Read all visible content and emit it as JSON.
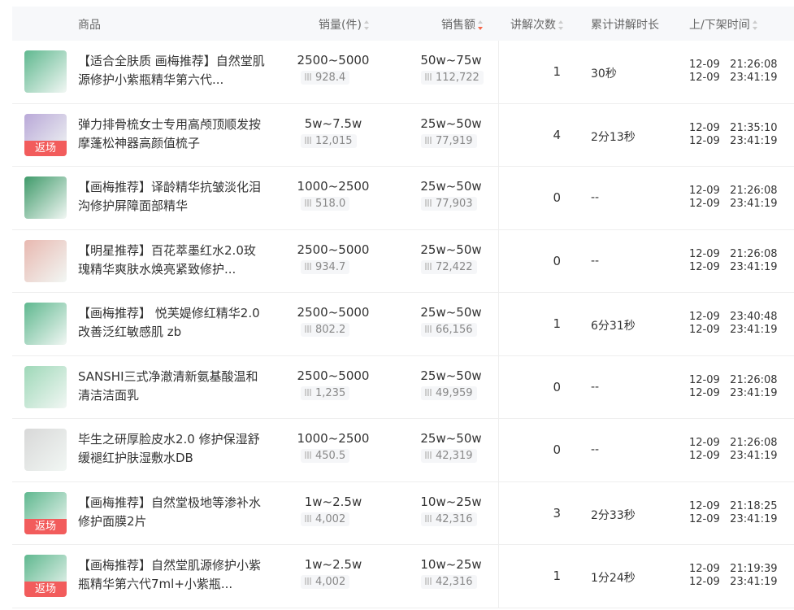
{
  "header": {
    "product": "商品",
    "qty": "销量(件)",
    "amount": "销售额",
    "count": "讲解次数",
    "duration": "累计讲解时长",
    "time": "上/下架时间"
  },
  "rows": [
    {
      "name": "【适合全肤质 画梅推荐】自然堂肌源修护小紫瓶精华第六代...",
      "qty": "2500~5000",
      "qty_sub": "928.4",
      "amt": "50w~75w",
      "amt_sub": "112,722",
      "count": "1",
      "dur": "30秒",
      "on": "12-09   21:26:08",
      "off": "12-09   23:41:19",
      "badge": "",
      "color": "#5fb88f"
    },
    {
      "name": "弹力排骨梳女士专用高颅顶顺发按摩蓬松神器高颜值梳子",
      "qty": "5w~7.5w",
      "qty_sub": "12,015",
      "amt": "25w~50w",
      "amt_sub": "77,919",
      "count": "4",
      "dur": "2分13秒",
      "on": "12-09   21:35:10",
      "off": "12-09   23:41:19",
      "badge": "返场",
      "color": "#b9a8d8"
    },
    {
      "name": "【画梅推荐】译龄精华抗皱淡化泪沟修护屏障面部精华",
      "qty": "1000~2500",
      "qty_sub": "518.0",
      "amt": "25w~50w",
      "amt_sub": "77,903",
      "count": "0",
      "dur": "--",
      "on": "12-09   21:26:08",
      "off": "12-09   23:41:19",
      "badge": "",
      "color": "#3f9a6a"
    },
    {
      "name": "【明星推荐】百花萃墨红水2.0玫瑰精华爽肤水焕亮紧致修护...",
      "qty": "2500~5000",
      "qty_sub": "934.7",
      "amt": "25w~50w",
      "amt_sub": "72,422",
      "count": "0",
      "dur": "--",
      "on": "12-09   21:26:08",
      "off": "12-09   23:41:19",
      "badge": "",
      "color": "#e8b8b0"
    },
    {
      "name": "【画梅推荐】 悦芙媞修红精华2.0改善泛红敏感肌 zb",
      "qty": "2500~5000",
      "qty_sub": "802.2",
      "amt": "25w~50w",
      "amt_sub": "66,156",
      "count": "1",
      "dur": "6分31秒",
      "on": "12-09   23:40:48",
      "off": "12-09   23:41:19",
      "badge": "",
      "color": "#5fb88f"
    },
    {
      "name": "SANSHI三式净澈清新氨基酸温和清洁洁面乳",
      "qty": "2500~5000",
      "qty_sub": "1,235",
      "amt": "25w~50w",
      "amt_sub": "49,959",
      "count": "0",
      "dur": "--",
      "on": "12-09   21:26:08",
      "off": "12-09   23:41:19",
      "badge": "",
      "color": "#9ed8b8"
    },
    {
      "name": "毕生之研厚脸皮水2.0 修护保湿舒缓褪红护肤湿敷水DB",
      "qty": "1000~2500",
      "qty_sub": "450.5",
      "amt": "25w~50w",
      "amt_sub": "42,319",
      "count": "0",
      "dur": "--",
      "on": "12-09   21:26:08",
      "off": "12-09   23:41:19",
      "badge": "",
      "color": "#d8d8d8"
    },
    {
      "name": "【画梅推荐】自然堂极地等渗补水修护面膜2片",
      "qty": "1w~2.5w",
      "qty_sub": "4,002",
      "amt": "10w~25w",
      "amt_sub": "42,316",
      "count": "3",
      "dur": "2分33秒",
      "on": "12-09   21:18:25",
      "off": "12-09   23:41:19",
      "badge": "返场",
      "color": "#5fb88f"
    },
    {
      "name": "【画梅推荐】自然堂肌源修护小紫瓶精华第六代7ml+小紫瓶...",
      "qty": "1w~2.5w",
      "qty_sub": "4,002",
      "amt": "10w~25w",
      "amt_sub": "42,316",
      "count": "1",
      "dur": "1分24秒",
      "on": "12-09   21:19:39",
      "off": "12-09   23:41:19",
      "badge": "返场",
      "color": "#5fb88f"
    }
  ]
}
